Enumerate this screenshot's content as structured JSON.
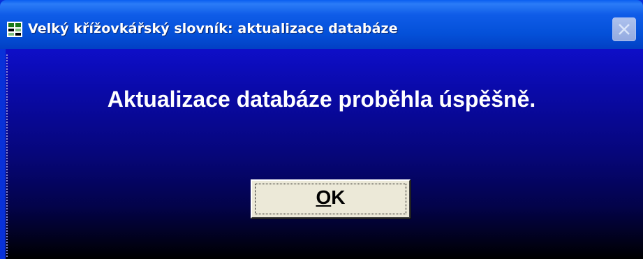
{
  "window": {
    "title": "Velký křížovkářský slovník: aktualizace databáze",
    "icon": "app-icon",
    "close_icon": "close-icon"
  },
  "dialog": {
    "message": "Aktualizace databáze proběhla úspěšně.",
    "ok_button": {
      "mnemonic": "O",
      "rest": "K"
    }
  },
  "colors": {
    "titlebar": "#0450d8",
    "client_top": "#0e0ec8",
    "client_bottom": "#000000",
    "button_face": "#ece9d8"
  }
}
